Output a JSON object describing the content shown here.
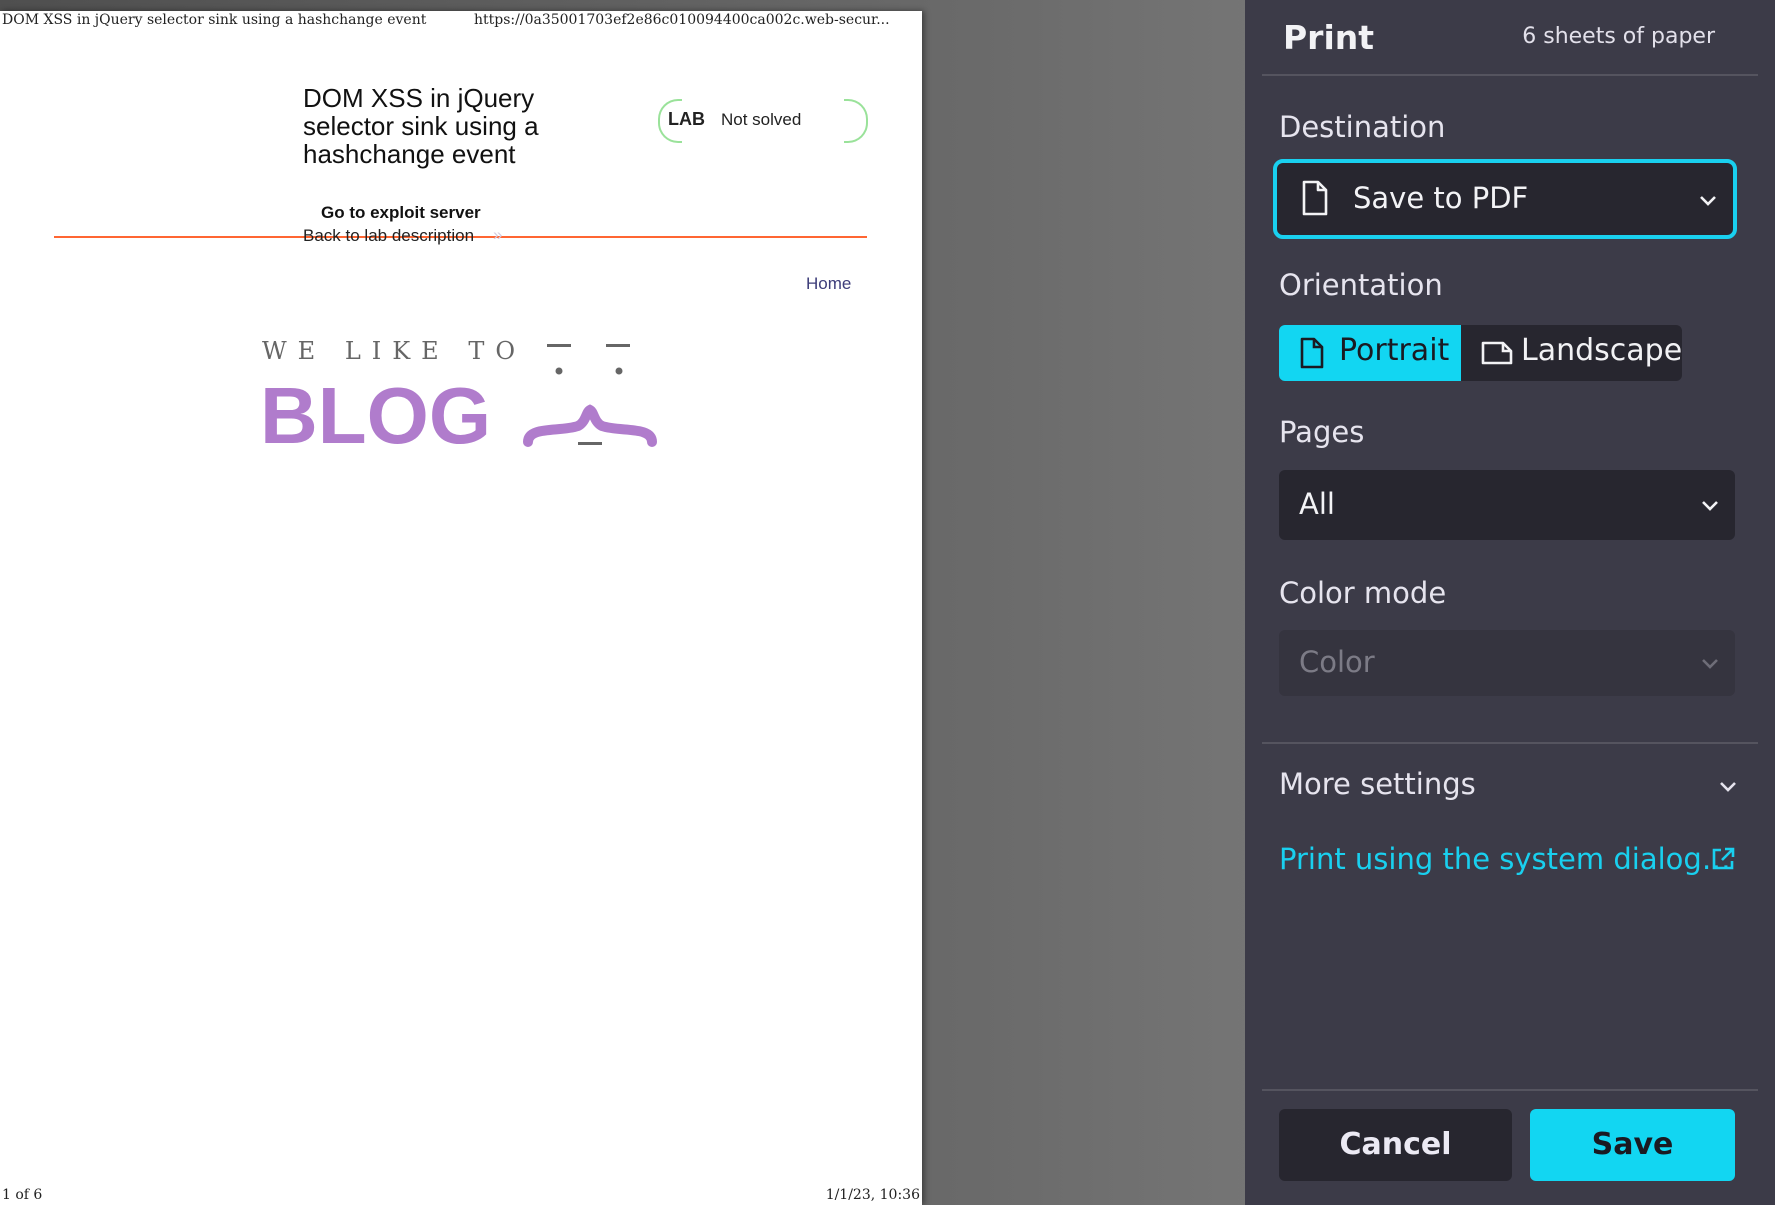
{
  "preview": {
    "header_title": "DOM XSS in jQuery selector sink using a hashchange event",
    "header_url": "https://0a35001703ef2e86c010094400ca002c.web-secur...",
    "footer_page": "1 of 6",
    "footer_datetime": "1/1/23, 10:36",
    "lab_title": "DOM XSS in jQuery selector sink using a hashchange event",
    "lab_badge": "LAB",
    "lab_status": "Not solved",
    "exploit_link": "Go to exploit server",
    "back_link": "Back to lab description",
    "back_arrow": "»",
    "home_link": "Home",
    "logo_small_text": "WE LIKE TO",
    "logo_big_text": "BLOG",
    "colors": {
      "accent_rule": "#ff6633",
      "logo_purple": "#b07ccc"
    }
  },
  "panel": {
    "title": "Print",
    "sheets": "6 sheets of paper",
    "destination_label": "Destination",
    "destination_value": "Save to PDF",
    "orientation_label": "Orientation",
    "portrait_label": "Portrait",
    "landscape_label": "Landscape",
    "selected_orientation": "Portrait",
    "pages_label": "Pages",
    "pages_value": "All",
    "color_mode_label": "Color mode",
    "color_mode_value": "Color",
    "more_settings": "More settings",
    "system_dialog_link": "Print using the system dialog…",
    "cancel": "Cancel",
    "save": "Save",
    "colors": {
      "accent": "#12d6f2",
      "panel_bg": "#3c3b48"
    }
  }
}
